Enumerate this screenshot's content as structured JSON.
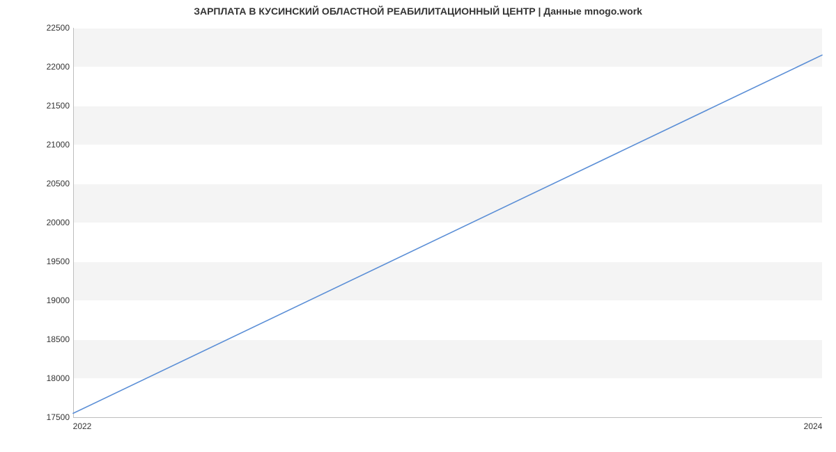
{
  "chart_data": {
    "type": "line",
    "title": "ЗАРПЛАТА В КУСИНСКИЙ ОБЛАСТНОЙ РЕАБИЛИТАЦИОННЫЙ ЦЕНТР | Данные mnogo.work",
    "x": [
      2022,
      2024
    ],
    "values": [
      17550,
      22150
    ],
    "xlabel": "",
    "ylabel": "",
    "x_ticks": [
      2022,
      2024
    ],
    "y_ticks": [
      17500,
      18000,
      18500,
      19000,
      19500,
      20000,
      20500,
      21000,
      21500,
      22000,
      22500
    ],
    "ylim": [
      17500,
      22500
    ],
    "xlim": [
      2022,
      2024
    ],
    "line_color": "#5a8ed6",
    "grid_band_color": "#f4f4f4"
  }
}
